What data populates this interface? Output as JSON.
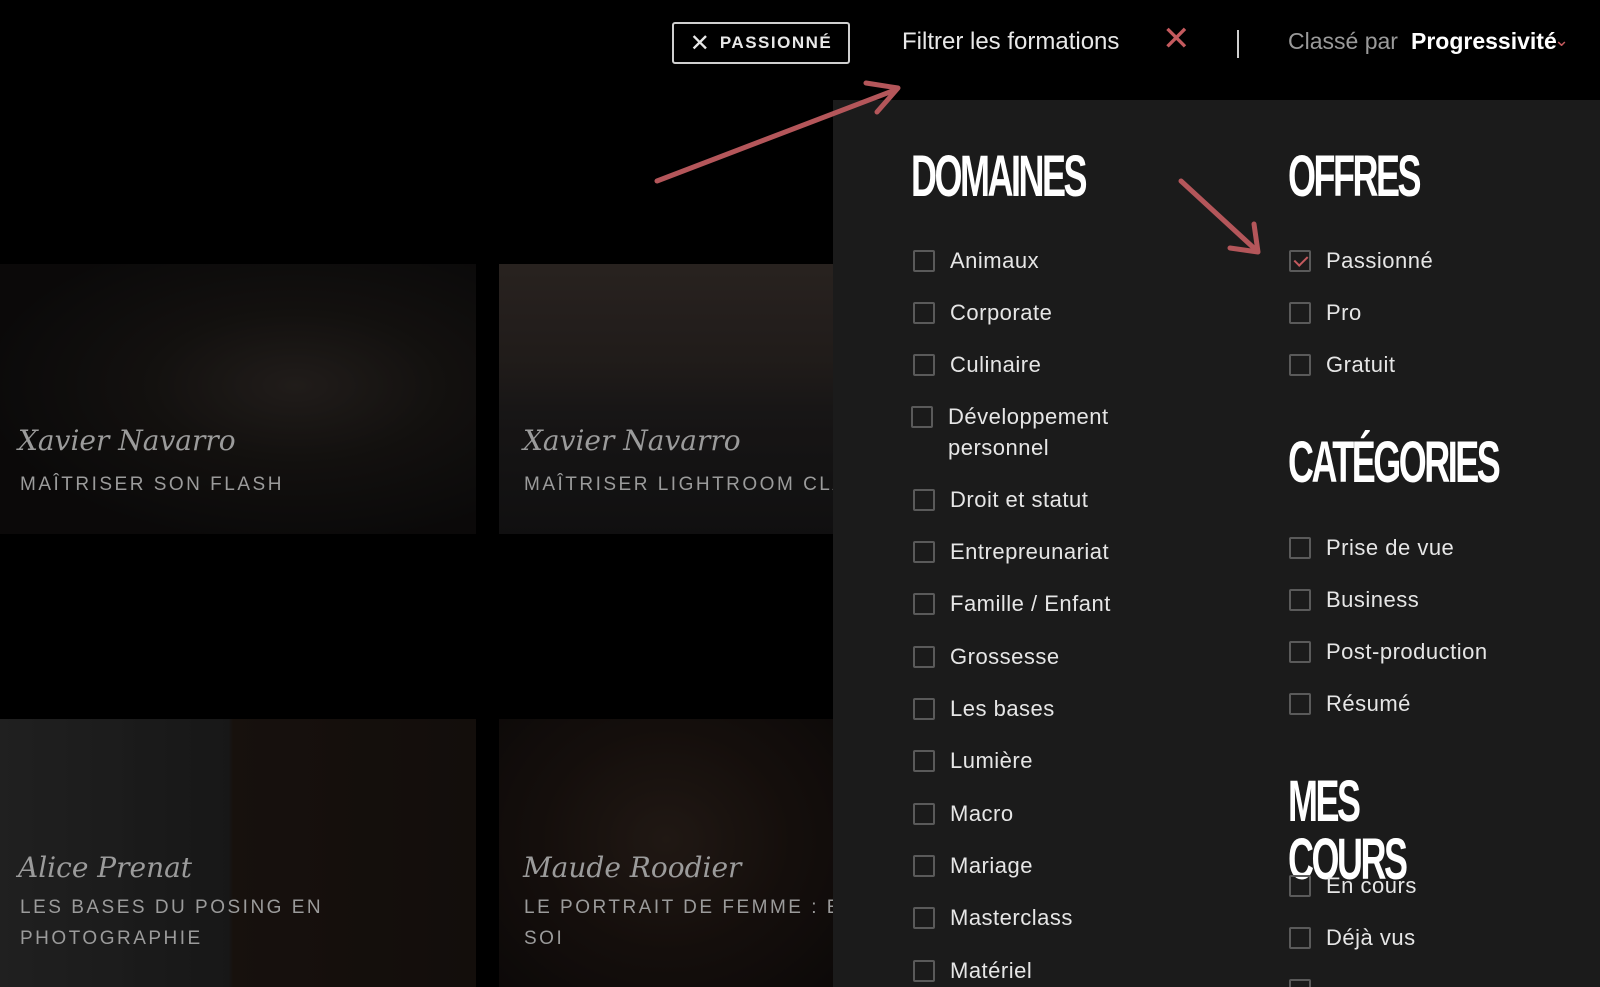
{
  "topbar": {
    "active_filter_chip": "PASSIONNÉ",
    "filter_title": "Filtrer les formations",
    "sort_label": "Classé par",
    "sort_value": "Progressivité"
  },
  "courses": [
    {
      "author": "Xavier Navarro",
      "title": "MAÎTRISER SON FLASH"
    },
    {
      "author": "Xavier Navarro",
      "title": "MAÎTRISER LIGHTROOM CLA"
    },
    {
      "author": "Alice Prenat",
      "title_line1": "LES BASES DU POSING EN",
      "title_line2": "PHOTOGRAPHIE"
    },
    {
      "author": "Maude Roodier",
      "title_line1": "LE PORTRAIT DE FEMME : E",
      "title_line2": "SOI"
    }
  ],
  "filters": {
    "domaines": {
      "heading": "DOMAINES",
      "items": [
        {
          "label": "Animaux",
          "checked": false
        },
        {
          "label": "Corporate",
          "checked": false
        },
        {
          "label": "Culinaire",
          "checked": false
        },
        {
          "label": "Développement personnel",
          "checked": false
        },
        {
          "label": "Droit et statut",
          "checked": false
        },
        {
          "label": "Entrepreunariat",
          "checked": false
        },
        {
          "label": "Famille / Enfant",
          "checked": false
        },
        {
          "label": "Grossesse",
          "checked": false
        },
        {
          "label": "Les bases",
          "checked": false
        },
        {
          "label": "Lumière",
          "checked": false
        },
        {
          "label": "Macro",
          "checked": false
        },
        {
          "label": "Mariage",
          "checked": false
        },
        {
          "label": "Masterclass",
          "checked": false
        },
        {
          "label": "Matériel",
          "checked": false
        }
      ]
    },
    "offres": {
      "heading": "OFFRES",
      "items": [
        {
          "label": "Passionné",
          "checked": true
        },
        {
          "label": "Pro",
          "checked": false
        },
        {
          "label": "Gratuit",
          "checked": false
        }
      ]
    },
    "categories": {
      "heading": "CATÉGORIES",
      "items": [
        {
          "label": "Prise de vue",
          "checked": false
        },
        {
          "label": "Business",
          "checked": false
        },
        {
          "label": "Post-production",
          "checked": false
        },
        {
          "label": "Résumé",
          "checked": false
        }
      ]
    },
    "mes_cours": {
      "heading": "MES COURS",
      "items": [
        {
          "label": "En cours",
          "checked": false
        },
        {
          "label": "Déjà vus",
          "checked": false
        }
      ]
    }
  },
  "colors": {
    "accent": "#c45a5e",
    "panel_bg": "#1b1b1b",
    "page_bg": "#000000"
  },
  "icons": {
    "chip_remove": "close-icon",
    "filter_close": "close-icon",
    "sort_dropdown": "chevron-down-icon"
  }
}
